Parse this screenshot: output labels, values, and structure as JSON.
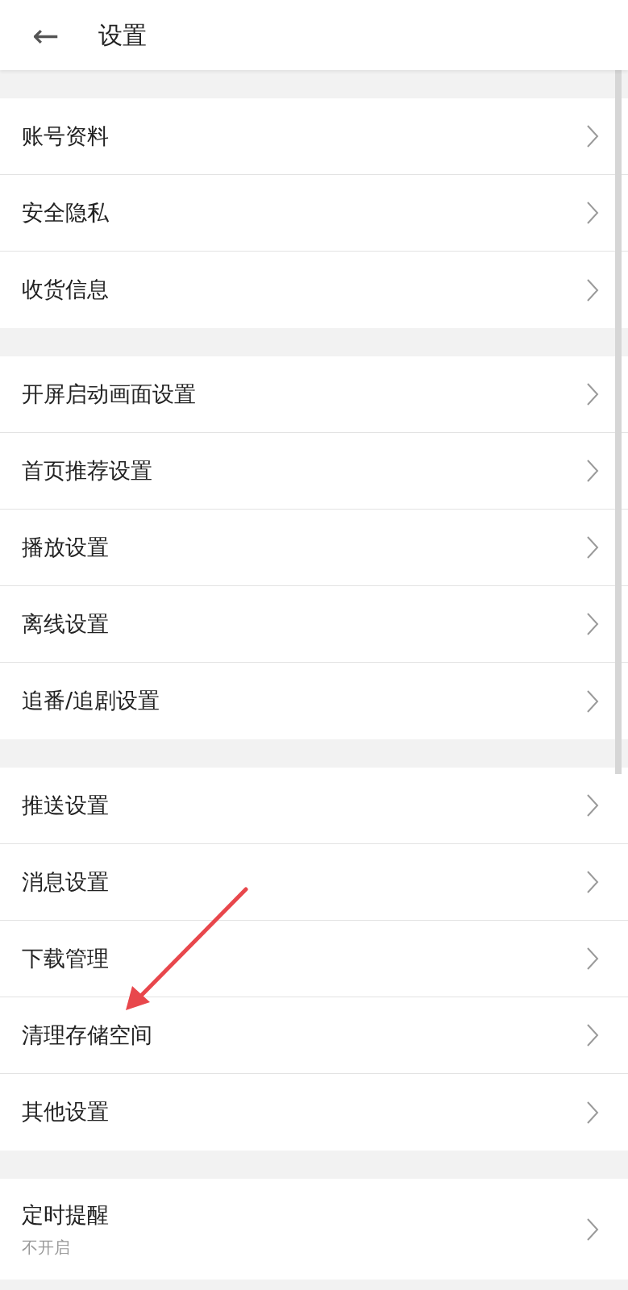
{
  "header": {
    "back": "←",
    "title": "设置"
  },
  "sections": [
    {
      "items": [
        {
          "label": "账号资料"
        },
        {
          "label": "安全隐私"
        },
        {
          "label": "收货信息"
        }
      ]
    },
    {
      "items": [
        {
          "label": "开屏启动画面设置"
        },
        {
          "label": "首页推荐设置"
        },
        {
          "label": "播放设置"
        },
        {
          "label": "离线设置"
        },
        {
          "label": "追番/追剧设置"
        }
      ]
    },
    {
      "items": [
        {
          "label": "推送设置"
        },
        {
          "label": "消息设置"
        },
        {
          "label": "下载管理"
        },
        {
          "label": "清理存储空间"
        },
        {
          "label": "其他设置"
        }
      ]
    },
    {
      "items": [
        {
          "label": "定时提醒",
          "subtitle": "不开启"
        }
      ]
    }
  ]
}
